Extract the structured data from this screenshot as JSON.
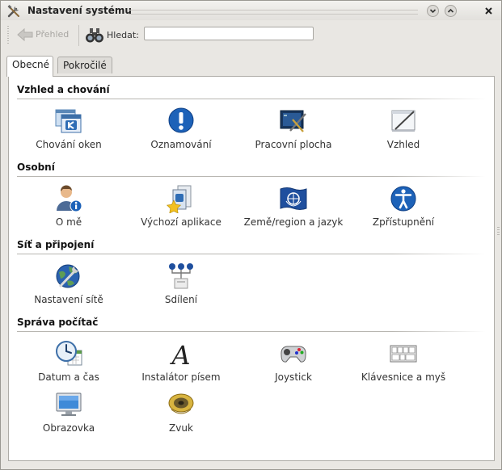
{
  "window": {
    "title": "Nastavení systému"
  },
  "toolbar": {
    "back_label": "Přehled",
    "search_label": "Hledat:",
    "search_value": "",
    "search_placeholder": ""
  },
  "tabs": [
    {
      "label": "Obecné",
      "active": true
    },
    {
      "label": "Pokročilé",
      "active": false
    }
  ],
  "sections": [
    {
      "title": "Vzhled a chování",
      "items": [
        {
          "label": "Chování oken",
          "icon": "window-behavior-icon"
        },
        {
          "label": "Oznamování",
          "icon": "notification-icon"
        },
        {
          "label": "Pracovní plocha",
          "icon": "desktop-icon"
        },
        {
          "label": "Vzhled",
          "icon": "appearance-icon"
        }
      ]
    },
    {
      "title": "Osobní",
      "items": [
        {
          "label": "O mě",
          "icon": "about-me-icon"
        },
        {
          "label": "Výchozí aplikace",
          "icon": "default-apps-icon"
        },
        {
          "label": "Země/region a jazyk",
          "icon": "locale-flag-icon"
        },
        {
          "label": "Zpřístupnění",
          "icon": "accessibility-icon"
        }
      ]
    },
    {
      "title": "Síť a připojení",
      "items": [
        {
          "label": "Nastavení sítě",
          "icon": "network-globe-icon"
        },
        {
          "label": "Sdílení",
          "icon": "sharing-icon"
        }
      ]
    },
    {
      "title": "Správa počítač",
      "items": [
        {
          "label": "Datum a čas",
          "icon": "clock-icon"
        },
        {
          "label": "Instalátor písem",
          "icon": "font-icon"
        },
        {
          "label": "Joystick",
          "icon": "joystick-icon"
        },
        {
          "label": "Klávesnice a myš",
          "icon": "keyboard-icon"
        },
        {
          "label": "Obrazovka",
          "icon": "monitor-icon"
        },
        {
          "label": "Zvuk",
          "icon": "speaker-icon"
        }
      ]
    }
  ]
}
